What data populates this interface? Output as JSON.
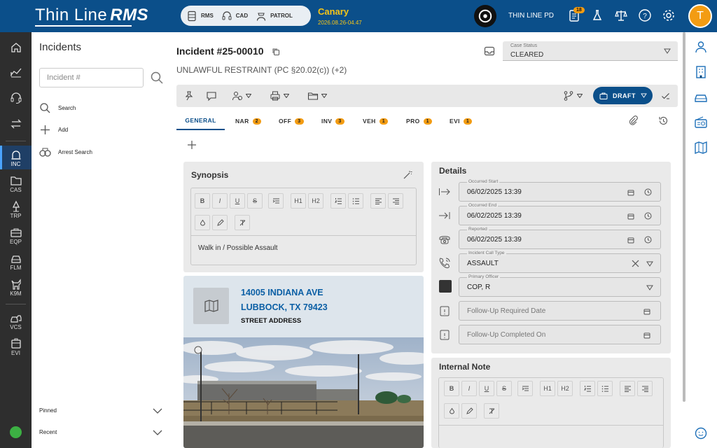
{
  "app": {
    "logo_thin": "Thin Line",
    "logo_rms": "RMS",
    "modules": [
      {
        "label": "RMS",
        "icon": "server-icon"
      },
      {
        "label": "CAD",
        "icon": "headset-icon"
      },
      {
        "label": "PATROL",
        "icon": "officer-icon"
      }
    ],
    "environment": {
      "name": "Canary",
      "version": "2026.08.26-04.47"
    },
    "org_name": "THIN LINE PD",
    "notification_count": "18",
    "user_initial": "T"
  },
  "rail": [
    {
      "label": "",
      "icon": "home-icon"
    },
    {
      "label": "",
      "icon": "analytics-icon"
    },
    {
      "label": "",
      "icon": "dispatch-headset-icon"
    },
    {
      "label": "",
      "icon": "transfer-icon"
    },
    {
      "label": "INC",
      "icon": "siren-icon",
      "active": true
    },
    {
      "label": "CAS",
      "icon": "folder-icon"
    },
    {
      "label": "TRP",
      "icon": "traffic-icon"
    },
    {
      "label": "EQP",
      "icon": "equipment-icon"
    },
    {
      "label": "FLM",
      "icon": "fleet-car-icon"
    },
    {
      "label": "K9M",
      "icon": "k9-icon"
    },
    {
      "label": "VCS",
      "icon": "vehicle-crash-icon"
    },
    {
      "label": "EVI",
      "icon": "evidence-icon"
    }
  ],
  "incidents_panel": {
    "title": "Incidents",
    "search_placeholder": "Incident #",
    "actions": [
      "Search",
      "Add",
      "Arrest Search"
    ],
    "sections": [
      "Pinned",
      "Recent"
    ]
  },
  "incident": {
    "number": "Incident #25-00010",
    "charge": "UNLAWFUL RESTRAINT (PC §20.02(c)) (+2)",
    "case_status_label": "Case Status",
    "case_status": "CLEARED",
    "draft_label": "DRAFT"
  },
  "tabs": [
    {
      "label": "GENERAL",
      "badge": ""
    },
    {
      "label": "NAR",
      "badge": "2"
    },
    {
      "label": "OFF",
      "badge": "3"
    },
    {
      "label": "INV",
      "badge": "3"
    },
    {
      "label": "VEH",
      "badge": "1"
    },
    {
      "label": "PRO",
      "badge": "1"
    },
    {
      "label": "EVI",
      "badge": "1"
    }
  ],
  "synopsis": {
    "title": "Synopsis",
    "text": "Walk in / Possible Assault",
    "tools": [
      "B",
      "I",
      "U",
      "S",
      "H1",
      "H2"
    ]
  },
  "location": {
    "line1": "14005 INDIANA AVE",
    "line2": "LUBBOCK, TX 79423",
    "type": "STREET ADDRESS"
  },
  "details": {
    "title": "Details",
    "occurred_start": {
      "label": "Occurred Start",
      "value": "06/02/2025 13:39"
    },
    "occurred_end": {
      "label": "Occurred End",
      "value": "06/02/2025 13:39"
    },
    "reported": {
      "label": "Reported",
      "value": "06/02/2025 13:39"
    },
    "call_type": {
      "label": "Incident Call Type",
      "value": "ASSAULT"
    },
    "primary_officer": {
      "label": "Primary Officer",
      "value": "COP, R"
    },
    "followup_required": {
      "placeholder": "Follow-Up Required Date"
    },
    "followup_completed": {
      "placeholder": "Follow-Up Completed On"
    }
  },
  "internal_note": {
    "title": "Internal Note"
  },
  "colors": {
    "brand": "#0b4f8a",
    "accent": "#f39c12",
    "env": "#f5c518",
    "link": "#0b5fa5"
  }
}
